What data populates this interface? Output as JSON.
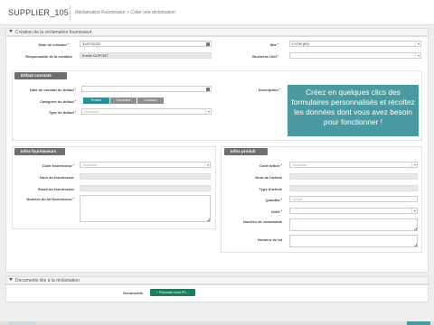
{
  "header": {
    "title": "SUPPLIER_105",
    "breadcrumb_root": "Réclamation Fournisseur",
    "breadcrumb_sep": ">",
    "breadcrumb_current": "Créer une réclamation"
  },
  "sections": {
    "creation": "Création de la réclamation fournisseur",
    "documents": "Documents liés à la réclamation"
  },
  "creation": {
    "date_label": "Date de création",
    "date_value": "31/07/2022",
    "site_label": "Site",
    "site_value": "LYON (69)",
    "resp_label": "Responsable de la création",
    "resp_value": "Emilie DUPONT",
    "bu_label": "Business Unit",
    "bu_value": ""
  },
  "defaut": {
    "title": "Défaut constaté",
    "date_label": "Date de constat du défaut",
    "desc_label": "Description",
    "cat_label": "Catégorie du défaut",
    "cat_options": [
      "Produit",
      "Document",
      "Livraison"
    ],
    "type_label": "Type de défaut",
    "type_placeholder": "Sélection"
  },
  "promo": {
    "text": "Créez en quelques clics des formulaires personnalisés et récoltez les données dont vous avez besoin pour fonctionner !"
  },
  "fournisseur": {
    "title": "Infos fournisseurs",
    "code_label": "Code fournisseur",
    "code_placeholder": "Sélection",
    "nom_label": "Nom du fournisseur",
    "email_label": "Email du fournisseur",
    "lot_label": "Numéro du lot fournisseur"
  },
  "produit": {
    "title": "Infos produit",
    "code_label": "Code article",
    "code_placeholder": "Sélection",
    "nom_label": "Nom de l'article",
    "type_label": "Type d'article",
    "qte_label": "Quantité",
    "qte_placeholder": "12345",
    "unite_label": "Unité",
    "cmd_label": "Numéro de commande",
    "lot_label": "Numéro de lot"
  },
  "documents": {
    "label": "Documents",
    "button": "+ Parcourir mon PC..."
  }
}
